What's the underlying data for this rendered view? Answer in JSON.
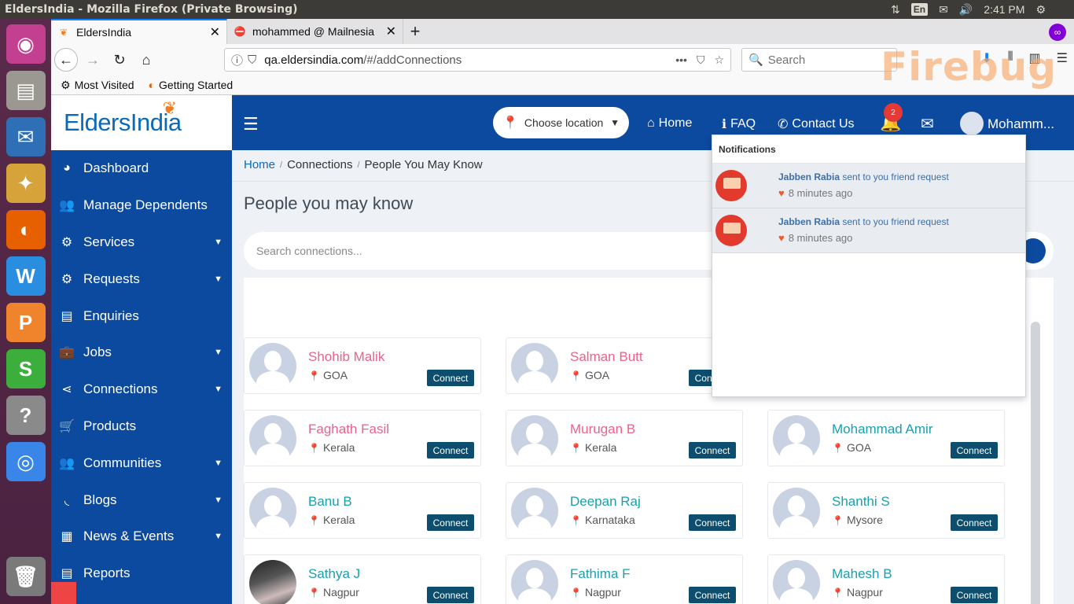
{
  "os": {
    "window_title": "EldersIndia - Mozilla Firefox (Private Browsing)",
    "keyboard_layout": "En",
    "clock": "2:41 PM",
    "launcher_apps": [
      {
        "name": "ubuntu-icon",
        "color": "#c2408f",
        "glyph": "◉"
      },
      {
        "name": "files-icon",
        "color": "#9a9890",
        "glyph": "▤"
      },
      {
        "name": "thunderbird-icon",
        "color": "#2f6fb5",
        "glyph": "✉"
      },
      {
        "name": "cleaner-icon",
        "color": "#d6a23a",
        "glyph": "✦"
      },
      {
        "name": "firefox-icon",
        "color": "#e66000",
        "glyph": "◐"
      },
      {
        "name": "writer-icon",
        "color": "#2a8ee0",
        "glyph": "W"
      },
      {
        "name": "presentation-icon",
        "color": "#f0842c",
        "glyph": "P"
      },
      {
        "name": "spreadsheet-icon",
        "color": "#3cae3c",
        "glyph": "S"
      },
      {
        "name": "help-icon",
        "color": "#8a8a8a",
        "glyph": "?"
      },
      {
        "name": "chrome-icon",
        "color": "#3a86e8",
        "glyph": "◎"
      }
    ]
  },
  "browser": {
    "tabs": [
      {
        "label": "EldersIndia",
        "active": true
      },
      {
        "label": "mohammed @ Mailnesia",
        "active": false
      }
    ],
    "url_host": "qa.eldersindia.com",
    "url_path": "/#/addConnections",
    "search_placeholder": "Search",
    "bookmarks": [
      "Most Visited",
      "Getting Started"
    ],
    "firebug_watermark": "Firebug"
  },
  "app": {
    "logo_text": "EldersIndia",
    "sidebar": [
      {
        "label": "Dashboard",
        "icon": "◕",
        "has_children": false
      },
      {
        "label": "Manage Dependents",
        "icon": "👥",
        "has_children": false
      },
      {
        "label": "Services",
        "icon": "⚙",
        "has_children": true
      },
      {
        "label": "Requests",
        "icon": "⚙",
        "has_children": true
      },
      {
        "label": "Enquiries",
        "icon": "▤",
        "has_children": false
      },
      {
        "label": "Jobs",
        "icon": "💼",
        "has_children": true
      },
      {
        "label": "Connections",
        "icon": "⋖",
        "has_children": true
      },
      {
        "label": "Products",
        "icon": "🛒",
        "has_children": false
      },
      {
        "label": "Communities",
        "icon": "👥",
        "has_children": true
      },
      {
        "label": "Blogs",
        "icon": "◟",
        "has_children": true
      },
      {
        "label": "News & Events",
        "icon": "▦",
        "has_children": true
      },
      {
        "label": "Reports",
        "icon": "▤",
        "has_children": false
      }
    ],
    "header": {
      "location_label": "Choose location",
      "nav_home": "Home",
      "nav_faq": "FAQ",
      "nav_contact": "Contact Us",
      "notification_count": "2",
      "user_name": "Mohamm..."
    },
    "breadcrumb": [
      "Home",
      "Connections",
      "People You May Know"
    ],
    "page_title": "People you may know",
    "search_placeholder": "Search connections...",
    "connect_label": "Connect",
    "people": [
      {
        "name": "Shohib Malik",
        "location": "GOA",
        "color": "pink",
        "photo": false
      },
      {
        "name": "Salman Butt",
        "location": "GOA",
        "color": "pink",
        "photo": false
      },
      {
        "name": "Faghath Fasil",
        "location": "Kerala",
        "color": "pink",
        "photo": false
      },
      {
        "name": "Murugan B",
        "location": "Kerala",
        "color": "pink",
        "photo": false
      },
      {
        "name": "Mohammad Amir",
        "location": "GOA",
        "color": "teal",
        "photo": false
      },
      {
        "name": "Banu B",
        "location": "Kerala",
        "color": "teal",
        "photo": false
      },
      {
        "name": "Deepan Raj",
        "location": "Karnataka",
        "color": "teal",
        "photo": false
      },
      {
        "name": "Shanthi S",
        "location": "Mysore",
        "color": "teal",
        "photo": false
      },
      {
        "name": "Sathya J",
        "location": "Nagpur",
        "color": "teal",
        "photo": true
      },
      {
        "name": "Fathima F",
        "location": "Nagpur",
        "color": "teal",
        "photo": false
      },
      {
        "name": "Mahesh B",
        "location": "Nagpur",
        "color": "teal",
        "photo": false
      }
    ],
    "notifications": {
      "title": "Notifications",
      "items": [
        {
          "user": "Jabben Rabia",
          "text": "sent to you friend request",
          "time": "8 minutes ago"
        },
        {
          "user": "Jabben Rabia",
          "text": "sent to you friend request",
          "time": "8 minutes ago"
        }
      ]
    }
  }
}
